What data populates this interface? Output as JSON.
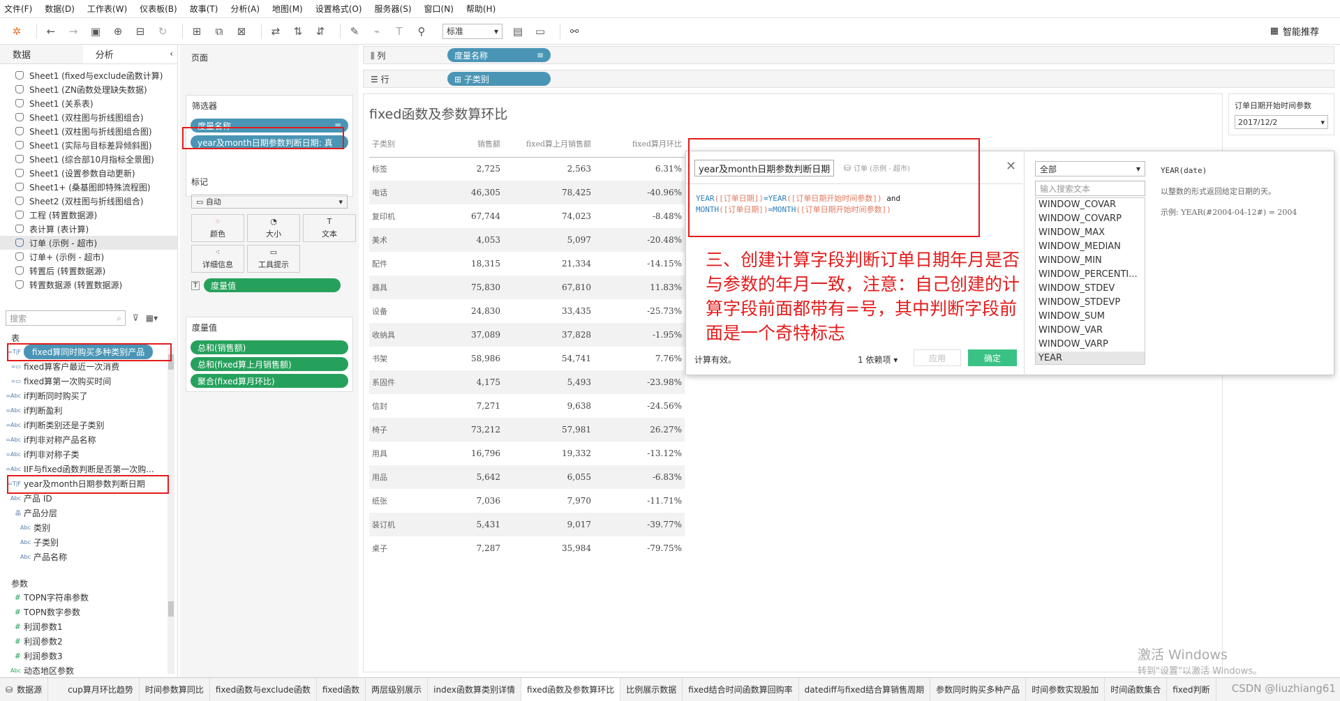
{
  "menu": [
    "文件(F)",
    "数据(D)",
    "工作表(W)",
    "仪表板(B)",
    "故事(T)",
    "分析(A)",
    "地图(M)",
    "设置格式(O)",
    "服务器(S)",
    "窗口(N)",
    "帮助(H)"
  ],
  "toolbar": {
    "mode_select": "标准",
    "smart_label": "智能推荐"
  },
  "left": {
    "tab_data": "数据",
    "tab_analysis": "分析",
    "datasources": [
      "Sheet1 (fixed与exclude函数计算)",
      "Sheet1 (ZN函数处理缺失数据)",
      "Sheet1 (关系表)",
      "Sheet1 (双柱图与折线图组合)",
      "Sheet1 (双柱图与折线图组合图)",
      "Sheet1 (实际与目标差异倾斜图)",
      "Sheet1 (综合部10月指标全景图)",
      "Sheet1 (设置参数自动更新)",
      "Sheet1+ (桑基图即特殊流程图)",
      "Sheet2 (双柱图与折线图组合)",
      "工程 (转置数据源)",
      "表计算 (表计算)",
      "订单 (示例 - 超市)",
      "订单+ (示例 - 超市)",
      "转置后 (转置数据源)",
      "转置数据源 (转置数据源)"
    ],
    "search_placeholder": "搜索",
    "tables_title": "表",
    "fields": [
      {
        "type": "=T|F",
        "name": "fixed算同时购买多种类别产品"
      },
      {
        "type": "=▭",
        "name": "fixed算客户最近一次消费"
      },
      {
        "type": "=▭",
        "name": "fixed算第一次购买时间"
      },
      {
        "type": "=Abc",
        "name": "if判断同时购买了"
      },
      {
        "type": "=Abc",
        "name": "if判断盈利"
      },
      {
        "type": "=Abc",
        "name": "if判断类别还是子类别"
      },
      {
        "type": "=Abc",
        "name": "if判非对称产品名称"
      },
      {
        "type": "=Abc",
        "name": "if判非对称子类"
      },
      {
        "type": "=Abc",
        "name": "IIF与fixed函数判断是否第一次购..."
      },
      {
        "type": "=T|F",
        "name": "year及month日期参数判断日期"
      },
      {
        "type": "Abc",
        "name": "产品 ID"
      },
      {
        "type": "品",
        "name": "产品分层"
      },
      {
        "type": "Abc",
        "name": "类别"
      },
      {
        "type": "Abc",
        "name": "子类别"
      },
      {
        "type": "Abc",
        "name": "产品名称"
      }
    ],
    "params_title": "参数",
    "params": [
      {
        "type": "#",
        "name": "TOPN字符串参数"
      },
      {
        "type": "#",
        "name": "TOPN数字参数"
      },
      {
        "type": "#",
        "name": "利润参数1"
      },
      {
        "type": "#",
        "name": "利润参数2"
      },
      {
        "type": "#",
        "name": "利润参数3"
      },
      {
        "type": "Abc",
        "name": "动态地区参数"
      }
    ]
  },
  "mid": {
    "pages_title": "页面",
    "filters_title": "筛选器",
    "filters": [
      "度量名称",
      "year及month日期参数判断日期: 真"
    ],
    "marks_title": "标记",
    "marks_type": "自动",
    "mark_buttons": [
      "颜色",
      "大小",
      "文本",
      "详细信息",
      "工具提示"
    ],
    "marks_pill": "度量值",
    "measure_values_title": "度量值",
    "measure_values": [
      "总和(销售额)",
      "总和(fixed算上月销售额)",
      "聚合(fixed算月环比)"
    ]
  },
  "shelves": {
    "columns_label": "列",
    "columns_pill": "度量名称",
    "rows_label": "行",
    "rows_pill": "子类别"
  },
  "viz": {
    "title": "fixed函数及参数算环比",
    "headers": [
      "子类别",
      "销售额",
      "fixed算上月销售额",
      "fixed算月环比"
    ],
    "rows": [
      [
        "标签",
        "2,725",
        "2,563",
        "6.31%"
      ],
      [
        "电话",
        "46,305",
        "78,425",
        "-40.96%"
      ],
      [
        "复印机",
        "67,744",
        "74,023",
        "-8.48%"
      ],
      [
        "美术",
        "4,053",
        "5,097",
        "-20.48%"
      ],
      [
        "配件",
        "18,315",
        "21,334",
        "-14.15%"
      ],
      [
        "器具",
        "75,830",
        "67,810",
        "11.83%"
      ],
      [
        "设备",
        "24,830",
        "33,435",
        "-25.73%"
      ],
      [
        "收纳具",
        "37,089",
        "37,828",
        "-1.95%"
      ],
      [
        "书架",
        "58,986",
        "54,741",
        "7.76%"
      ],
      [
        "系固件",
        "4,175",
        "5,493",
        "-23.98%"
      ],
      [
        "信封",
        "7,271",
        "9,638",
        "-24.56%"
      ],
      [
        "椅子",
        "73,212",
        "57,981",
        "26.27%"
      ],
      [
        "用具",
        "16,796",
        "19,332",
        "-13.12%"
      ],
      [
        "用品",
        "5,642",
        "6,055",
        "-6.83%"
      ],
      [
        "纸张",
        "7,036",
        "7,970",
        "-11.71%"
      ],
      [
        "装订机",
        "5,431",
        "9,017",
        "-39.77%"
      ],
      [
        "桌子",
        "7,287",
        "35,984",
        "-79.75%"
      ]
    ]
  },
  "param_panel": {
    "title": "订单日期开始时间参数",
    "value": "2017/12/2"
  },
  "calc": {
    "name": "year及month日期参数判断日期",
    "source": "订单 (示例 - 超市)",
    "f_year": "YEAR",
    "f_field1": "([订单日期])",
    "f_eq1": "=YEAR",
    "f_param1": "([订单日期开始时间参数])",
    "f_and": " and",
    "f_month": "MONTH",
    "f_field2": "([订单日期])",
    "f_eq2": "=MONTH",
    "f_param2": "([订单日期开始时间参数])",
    "valid": "计算有效。",
    "deps": "1 依赖项 ▾",
    "apply": "应用",
    "ok": "确定",
    "annotation": "三、创建计算字段判断订单日期年月是否与参数的年月一致，注意：自己创建的计算字段前面都带有=号，其中判断字段前面是一个奇特标志",
    "func_category": "全部",
    "func_search": "输入搜索文本",
    "functions": [
      "WINDOW_COVAR",
      "WINDOW_COVARP",
      "WINDOW_MAX",
      "WINDOW_MEDIAN",
      "WINDOW_MIN",
      "WINDOW_PERCENTI...",
      "WINDOW_STDEV",
      "WINDOW_STDEVP",
      "WINDOW_SUM",
      "WINDOW_VAR",
      "WINDOW_VARP",
      "YEAR"
    ],
    "help_sig": "YEAR(date)",
    "help_desc": "以整数的形式返回给定日期的天。",
    "help_example": "示例: YEAR(#2004-04-12#) = 2004"
  },
  "bottom_tabs": [
    "数据源",
    "cup算月环比趋势",
    "时间参数算同比",
    "fixed函数与exclude函数",
    "fixed函数",
    "两层级别展示",
    "index函数算类别详情",
    "fixed函数及参数算环比",
    "比例展示数据",
    "fixed结合时间函数算回购率",
    "datediff与fixed结合算销售周期",
    "参数同时购买多种产品",
    "时间参数实现股加",
    "时间函数集合",
    "fixed判断"
  ],
  "watermark": {
    "line1": "激活 Windows",
    "line2": "转到\"设置\"以激活 Windows。"
  },
  "csdn": "CSDN @liuzhiang61"
}
